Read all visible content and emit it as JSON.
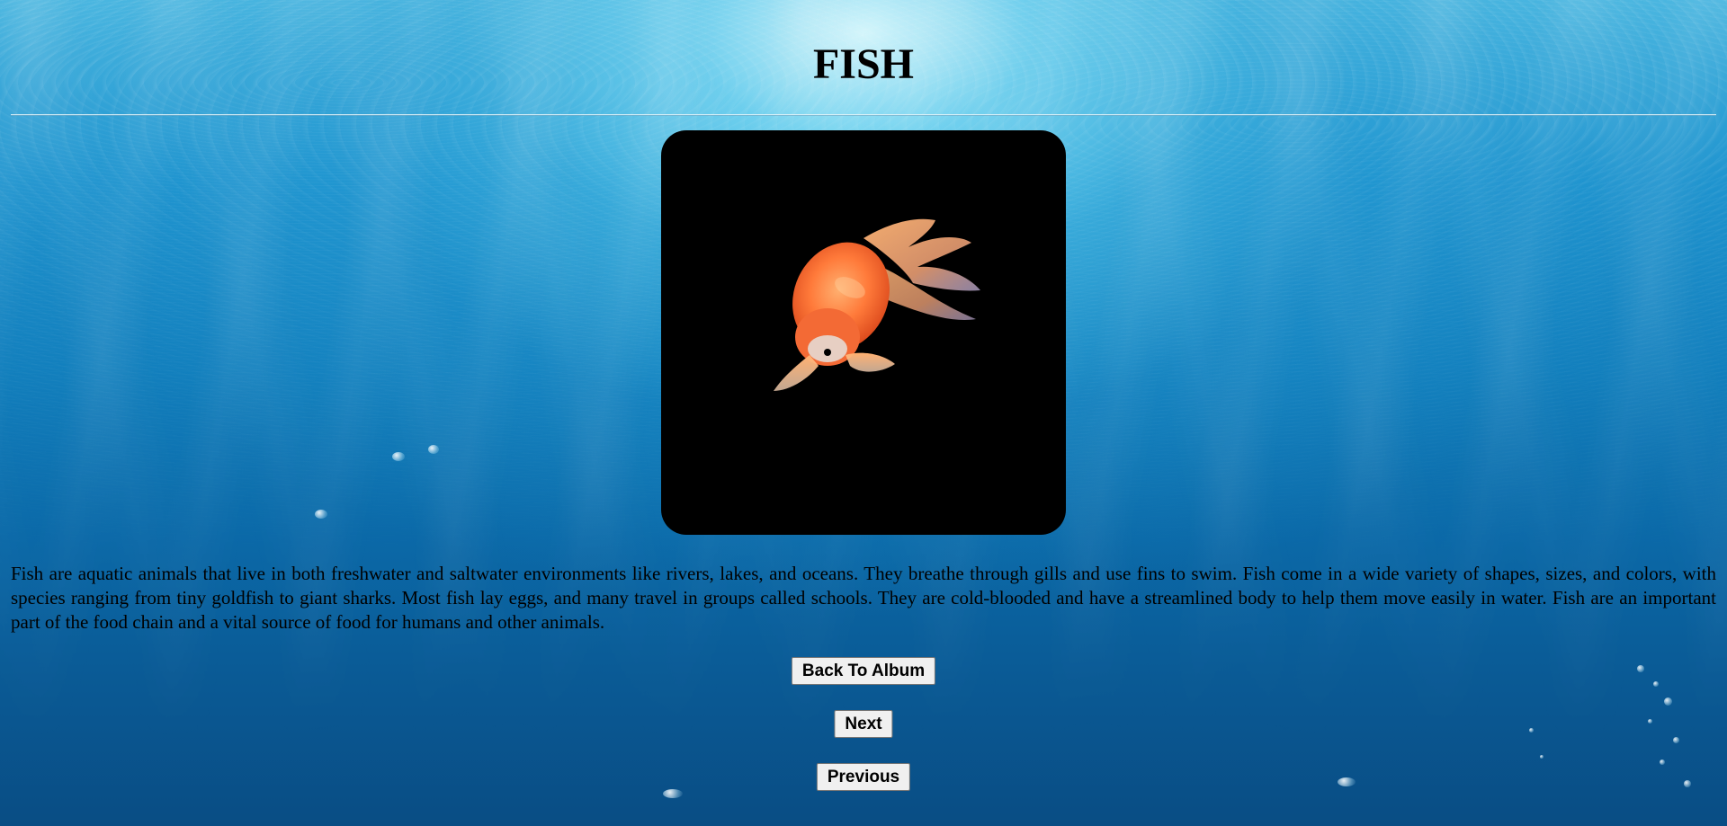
{
  "page": {
    "title": "FISH",
    "description": "Fish are aquatic animals that live in both freshwater and saltwater environments like rivers, lakes, and oceans. They breathe through gills and use fins to swim. Fish come in a wide variety of shapes, sizes, and colors, with species ranging from tiny goldfish to giant sharks. Most fish lay eggs, and many travel in groups called schools. They are cold-blooded and have a streamlined body to help them move easily in water. Fish are an important part of the food chain and a vital source of food for humans and other animals."
  },
  "buttons": {
    "back_label": "Back To Album",
    "next_label": "Next",
    "previous_label": "Previous"
  },
  "theme": {
    "background": "underwater-blue",
    "photo_background": "#000000"
  }
}
